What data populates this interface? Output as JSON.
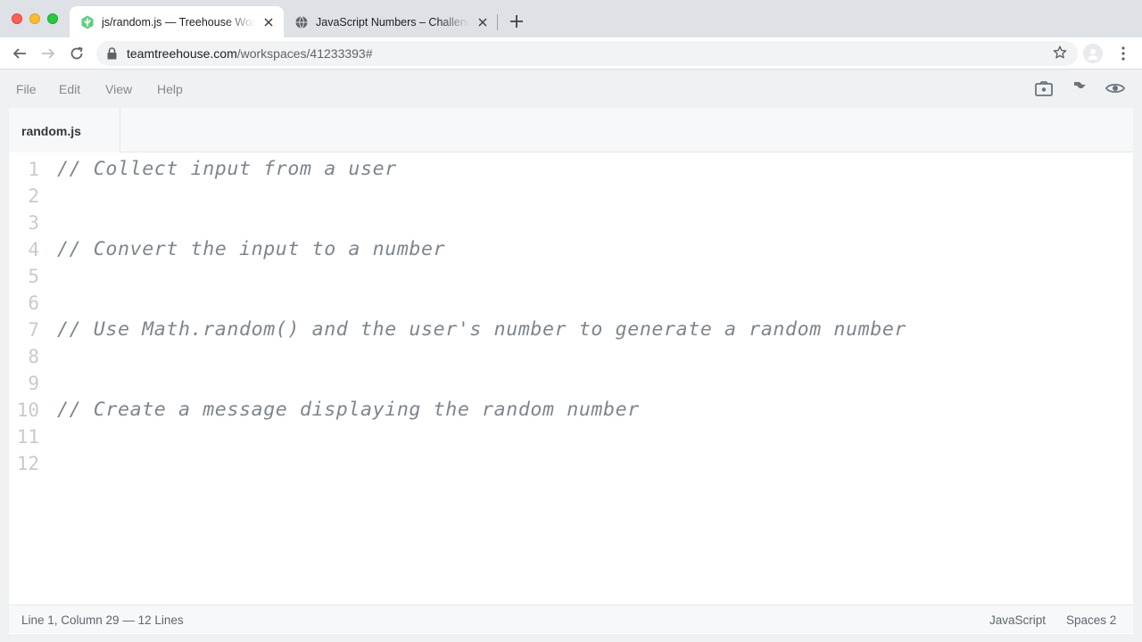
{
  "browser": {
    "tabs": [
      {
        "title": "js/random.js — Treehouse Workspaces",
        "favicon": "treehouse-icon",
        "active": true
      },
      {
        "title": "JavaScript Numbers – Challenge",
        "favicon": "globe-icon",
        "active": false
      }
    ],
    "url_domain": "teamtreehouse.com",
    "url_path": "/workspaces/41233393#"
  },
  "menu": {
    "items": [
      "File",
      "Edit",
      "View",
      "Help"
    ],
    "icons": [
      "camera-icon",
      "share-icon",
      "preview-eye-icon"
    ]
  },
  "editor": {
    "file_tab": "random.js",
    "lines": [
      {
        "num": "1",
        "text": "// Collect input from a user"
      },
      {
        "num": "2",
        "text": ""
      },
      {
        "num": "3",
        "text": ""
      },
      {
        "num": "4",
        "text": "// Convert the input to a number"
      },
      {
        "num": "5",
        "text": ""
      },
      {
        "num": "6",
        "text": ""
      },
      {
        "num": "7",
        "text": "// Use Math.random() and the user's number to generate a random number"
      },
      {
        "num": "8",
        "text": ""
      },
      {
        "num": "9",
        "text": ""
      },
      {
        "num": "10",
        "text": "// Create a message displaying the random number"
      },
      {
        "num": "11",
        "text": ""
      },
      {
        "num": "12",
        "text": ""
      }
    ]
  },
  "status": {
    "position": "Line 1, Column 29 — 12 Lines",
    "language": "JavaScript",
    "indent": "Spaces  2"
  },
  "colors": {
    "accent_green": "#5fcf80",
    "comment": "#7d868e",
    "line_number": "#c6cbd0"
  }
}
